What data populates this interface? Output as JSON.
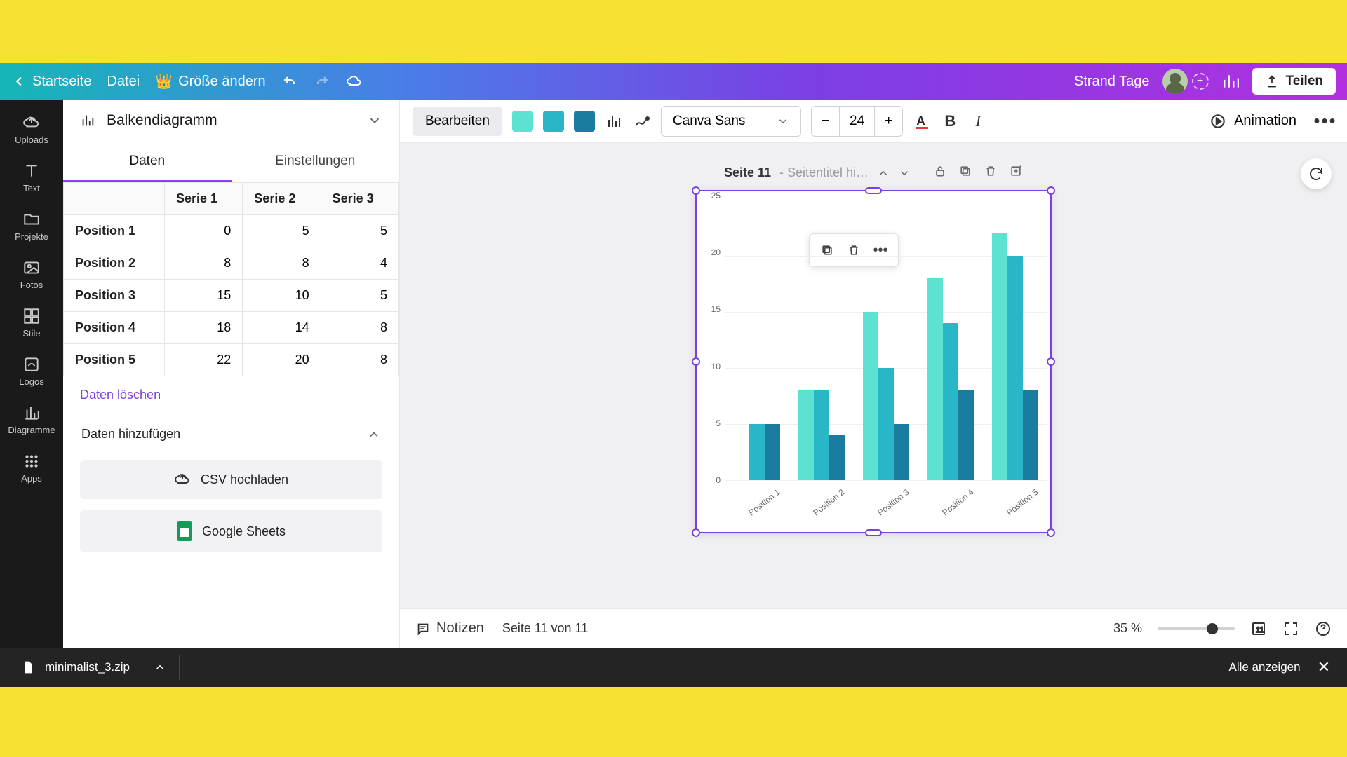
{
  "header": {
    "home": "Startseite",
    "file": "Datei",
    "resize": "Größe ändern",
    "project_name": "Strand Tage",
    "share": "Teilen"
  },
  "sidenav": {
    "uploads": "Uploads",
    "text": "Text",
    "projects": "Projekte",
    "photos": "Fotos",
    "styles": "Stile",
    "logos": "Logos",
    "charts": "Diagramme",
    "apps": "Apps"
  },
  "panel": {
    "chart_type": "Balkendiagramm",
    "tab_data": "Daten",
    "tab_settings": "Einstellungen",
    "columns": [
      "",
      "Serie 1",
      "Serie 2",
      "Serie 3"
    ],
    "rows": [
      {
        "label": "Position 1",
        "v": [
          0,
          5,
          5
        ]
      },
      {
        "label": "Position 2",
        "v": [
          8,
          8,
          4
        ]
      },
      {
        "label": "Position 3",
        "v": [
          15,
          10,
          5
        ]
      },
      {
        "label": "Position 4",
        "v": [
          18,
          14,
          8
        ]
      },
      {
        "label": "Position 5",
        "v": [
          22,
          20,
          8
        ]
      }
    ],
    "clear": "Daten löschen",
    "add_data": "Daten hinzufügen",
    "upload_csv": "CSV hochladen",
    "gsheets": "Google Sheets"
  },
  "toolbar": {
    "edit": "Bearbeiten",
    "font": "Canva Sans",
    "fontsize": "24",
    "animation": "Animation",
    "colors": [
      "#5de2d2",
      "#29b6c6",
      "#1a7ca0"
    ]
  },
  "page": {
    "label": "Seite 11",
    "subtitle": "- Seitentitel hi…",
    "y_ticks": [
      "25",
      "20",
      "15",
      "10",
      "5",
      "0"
    ]
  },
  "bottom": {
    "notes": "Notizen",
    "page_of": "Seite 11 von 11",
    "zoom": "35 %"
  },
  "download": {
    "filename": "minimalist_3.zip",
    "show_all": "Alle anzeigen"
  },
  "chart_data": {
    "type": "bar",
    "categories": [
      "Position 1",
      "Position 2",
      "Position 3",
      "Position 4",
      "Position 5"
    ],
    "series": [
      {
        "name": "Serie 1",
        "color": "#5de2d2",
        "values": [
          0,
          8,
          15,
          18,
          22
        ]
      },
      {
        "name": "Serie 2",
        "color": "#29b6c6",
        "values": [
          5,
          8,
          10,
          14,
          20
        ]
      },
      {
        "name": "Serie 3",
        "color": "#1a7ca0",
        "values": [
          5,
          4,
          5,
          8,
          8
        ]
      }
    ],
    "ylim": [
      0,
      25
    ],
    "xlabel": "",
    "ylabel": "",
    "title": ""
  }
}
